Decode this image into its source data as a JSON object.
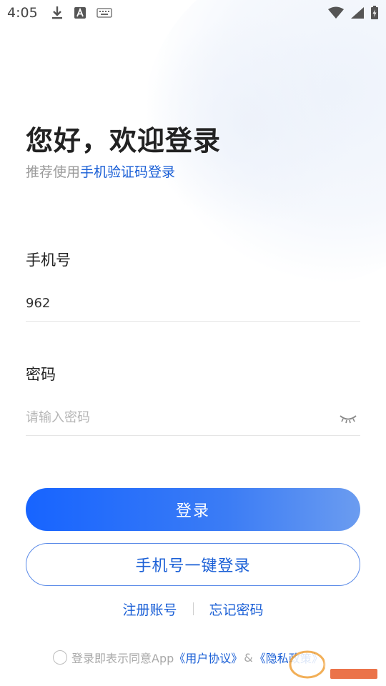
{
  "status_bar": {
    "time": "4:05",
    "icons_left": [
      "download-icon",
      "font-a-icon",
      "keyboard-icon"
    ],
    "icons_right": [
      "wifi-icon",
      "signal-icon",
      "battery-charging-icon"
    ]
  },
  "header": {
    "title": "您好，欢迎登录",
    "subtitle_prefix": "推荐使用",
    "subtitle_link": "手机验证码登录"
  },
  "phone": {
    "label": "手机号",
    "value": "962",
    "placeholder": ""
  },
  "password": {
    "label": "密码",
    "value": "",
    "placeholder": "请输入密码"
  },
  "buttons": {
    "login": "登录",
    "one_key_login": "手机号一键登录"
  },
  "links": {
    "register": "注册账号",
    "forgot": "忘记密码"
  },
  "agreement": {
    "prefix": "登录即表示同意App",
    "user_agreement": "《用户协议》",
    "amp": "&",
    "privacy": "《隐私政策》"
  },
  "colors": {
    "accent": "#1a5fd6",
    "button_gradient_start": "#1764ff",
    "button_gradient_end": "#6b9cf0"
  }
}
